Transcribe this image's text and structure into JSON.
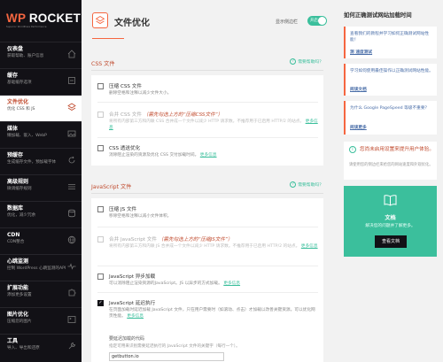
{
  "logo": {
    "main_prefix": "WP",
    "main_suffix": " ROCKET",
    "tagline": "Superior WordPress Performance"
  },
  "sidebar": {
    "items": [
      {
        "title": "仪表盘",
        "sub": "获取帮助、账户信息"
      },
      {
        "title": "缓存",
        "sub": "基础缓存选项"
      },
      {
        "title": "文件优化",
        "sub": "优化 CSS 和 JS"
      },
      {
        "title": "媒体",
        "sub": "懒加载、嵌入、WebP"
      },
      {
        "title": "预缓存",
        "sub": "生成缓存文件，预加载字体"
      },
      {
        "title": "高级规则",
        "sub": "微调缓存规则"
      },
      {
        "title": "数据库",
        "sub": "优化，减少冗余"
      },
      {
        "title": "CDN",
        "sub": "CDN整合"
      },
      {
        "title": "心跳监测",
        "sub": "控制 WordPress 心跳监测的API"
      },
      {
        "title": "扩展功能",
        "sub": "添加更多设置"
      },
      {
        "title": "图片优化",
        "sub": "压缩您的图片"
      },
      {
        "title": "工具",
        "sub": "导入、导出和还原"
      }
    ]
  },
  "header": {
    "title": "文件优化",
    "toggle_label": "显示侧边栏",
    "toggle_state": "开启"
  },
  "css_section": {
    "title": "CSS 文件",
    "help": "需要帮助吗？"
  },
  "css_options": [
    {
      "label": "压缩 CSS 文件",
      "hint": "",
      "desc": "删除空格和注释以减少文件大小。",
      "more": "",
      "checked": false,
      "disabled": false
    },
    {
      "label": "合并 CSS 文件",
      "hint": "（需先勾选上方的“压缩CSS文件”）",
      "desc": "将所有内部第三方和内联 CSS 合并成一个文件以减少 HTTP 请求数。不推荐用于已启用 HTTP/2 的站点。",
      "more": "更多信息",
      "checked": false,
      "disabled": true
    },
    {
      "label": "CSS 透送优化",
      "hint": "",
      "desc": "消除阻止渲染的资源及优化 CSS 交付加载时间。",
      "more": "更多信息",
      "checked": false,
      "disabled": false
    }
  ],
  "js_section": {
    "title": "JavaScript 文件",
    "help": "需要帮助吗？"
  },
  "js_options": [
    {
      "label": "压缩 JS 文件",
      "hint": "",
      "desc": "移除空格和注释以减小文件体积。",
      "more": "",
      "checked": false,
      "disabled": false
    },
    {
      "label": "合并 JavaScript 文件",
      "hint": "（需先勾选上方的“压缩JS文件”）",
      "desc": "将所有内部第三方和内联 JS 合并成一个文件以减少 HTTP 请求数。不推荐用于已启用 HTTP/2 的站点。",
      "more": "更多信息",
      "checked": false,
      "disabled": true
    },
    {
      "label": "JavaScript 异步加载",
      "hint": "",
      "desc": "可以消除阻止渲染资源的JavaScript。JS 以异步的方式加载。",
      "more": "更多信息",
      "checked": false,
      "disabled": false
    },
    {
      "label": "JavaScript 延迟执行",
      "hint": "",
      "desc": "在页面加载时延迟加载 JavaScript 文件，只在用户需要时（如滚动、点击）才加载以改善关键资源。可以优化网页性能。",
      "more": "更多信息",
      "checked": true,
      "disabled": false
    }
  ],
  "delay_sub": {
    "label": "要延迟加载的代码",
    "desc": "指定可用来识别需要延迟执行的 JavaScript 文件的关键字（每行一个）。",
    "value": "getbutton.io"
  },
  "aside": {
    "title": "如何正确测试网站加载时间",
    "boxes": [
      {
        "q": "查看我们的教程并学习如何正确测试网站性能！",
        "link": "测 速度测试"
      },
      {
        "q": "学习如何使用最佳操作以正确测试网站性能。",
        "link": "阅读文档"
      },
      {
        "q": "为什么 Google PageSpeed 等级不重要？",
        "link": "阅读更多"
      }
    ],
    "need": {
      "title": "您尚未启用设置来提升用户体验。",
      "desc": "请使用您的侧边栏来给您的网站速度和外观优化。"
    },
    "doc": {
      "title": "文档",
      "desc": "解决您的问题并了解更多。",
      "button": "查看文档"
    }
  },
  "colors": {
    "brand": "#f56640",
    "accent": "#3bbf9c",
    "sidebar_bg": "#121116",
    "active_text": "#c04a2d"
  }
}
